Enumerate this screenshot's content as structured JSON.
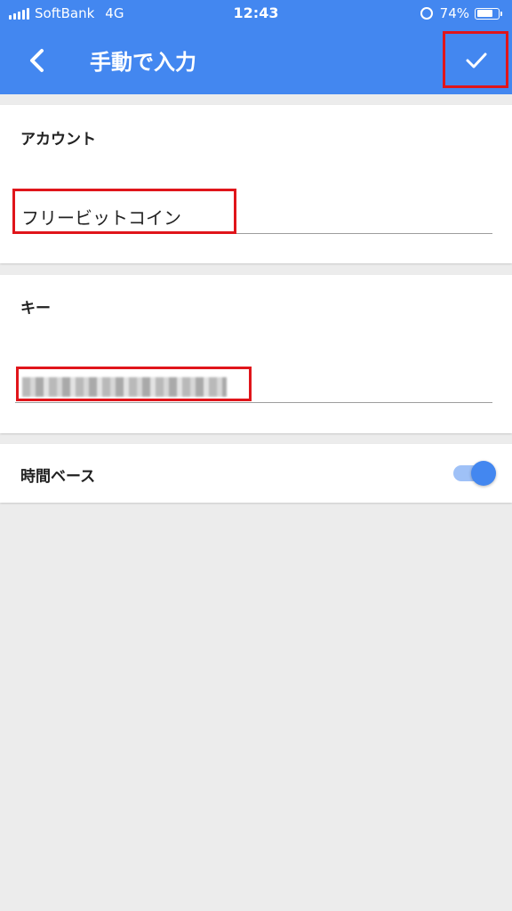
{
  "status_bar": {
    "carrier": "SoftBank",
    "network": "4G",
    "time": "12:43",
    "battery_percent": "74%",
    "battery_level": 0.74
  },
  "app_bar": {
    "title": "手動で入力",
    "back_icon": "chevron-left-icon",
    "save_icon": "check-icon"
  },
  "account": {
    "label": "アカウント",
    "value": "フリービットコイン"
  },
  "key": {
    "label": "キー",
    "value_state": "pixelated"
  },
  "time_based": {
    "label": "時間ベース",
    "enabled": true
  },
  "colors": {
    "primary": "#4387f0",
    "highlight": "#e0151b",
    "background": "#ececec"
  }
}
